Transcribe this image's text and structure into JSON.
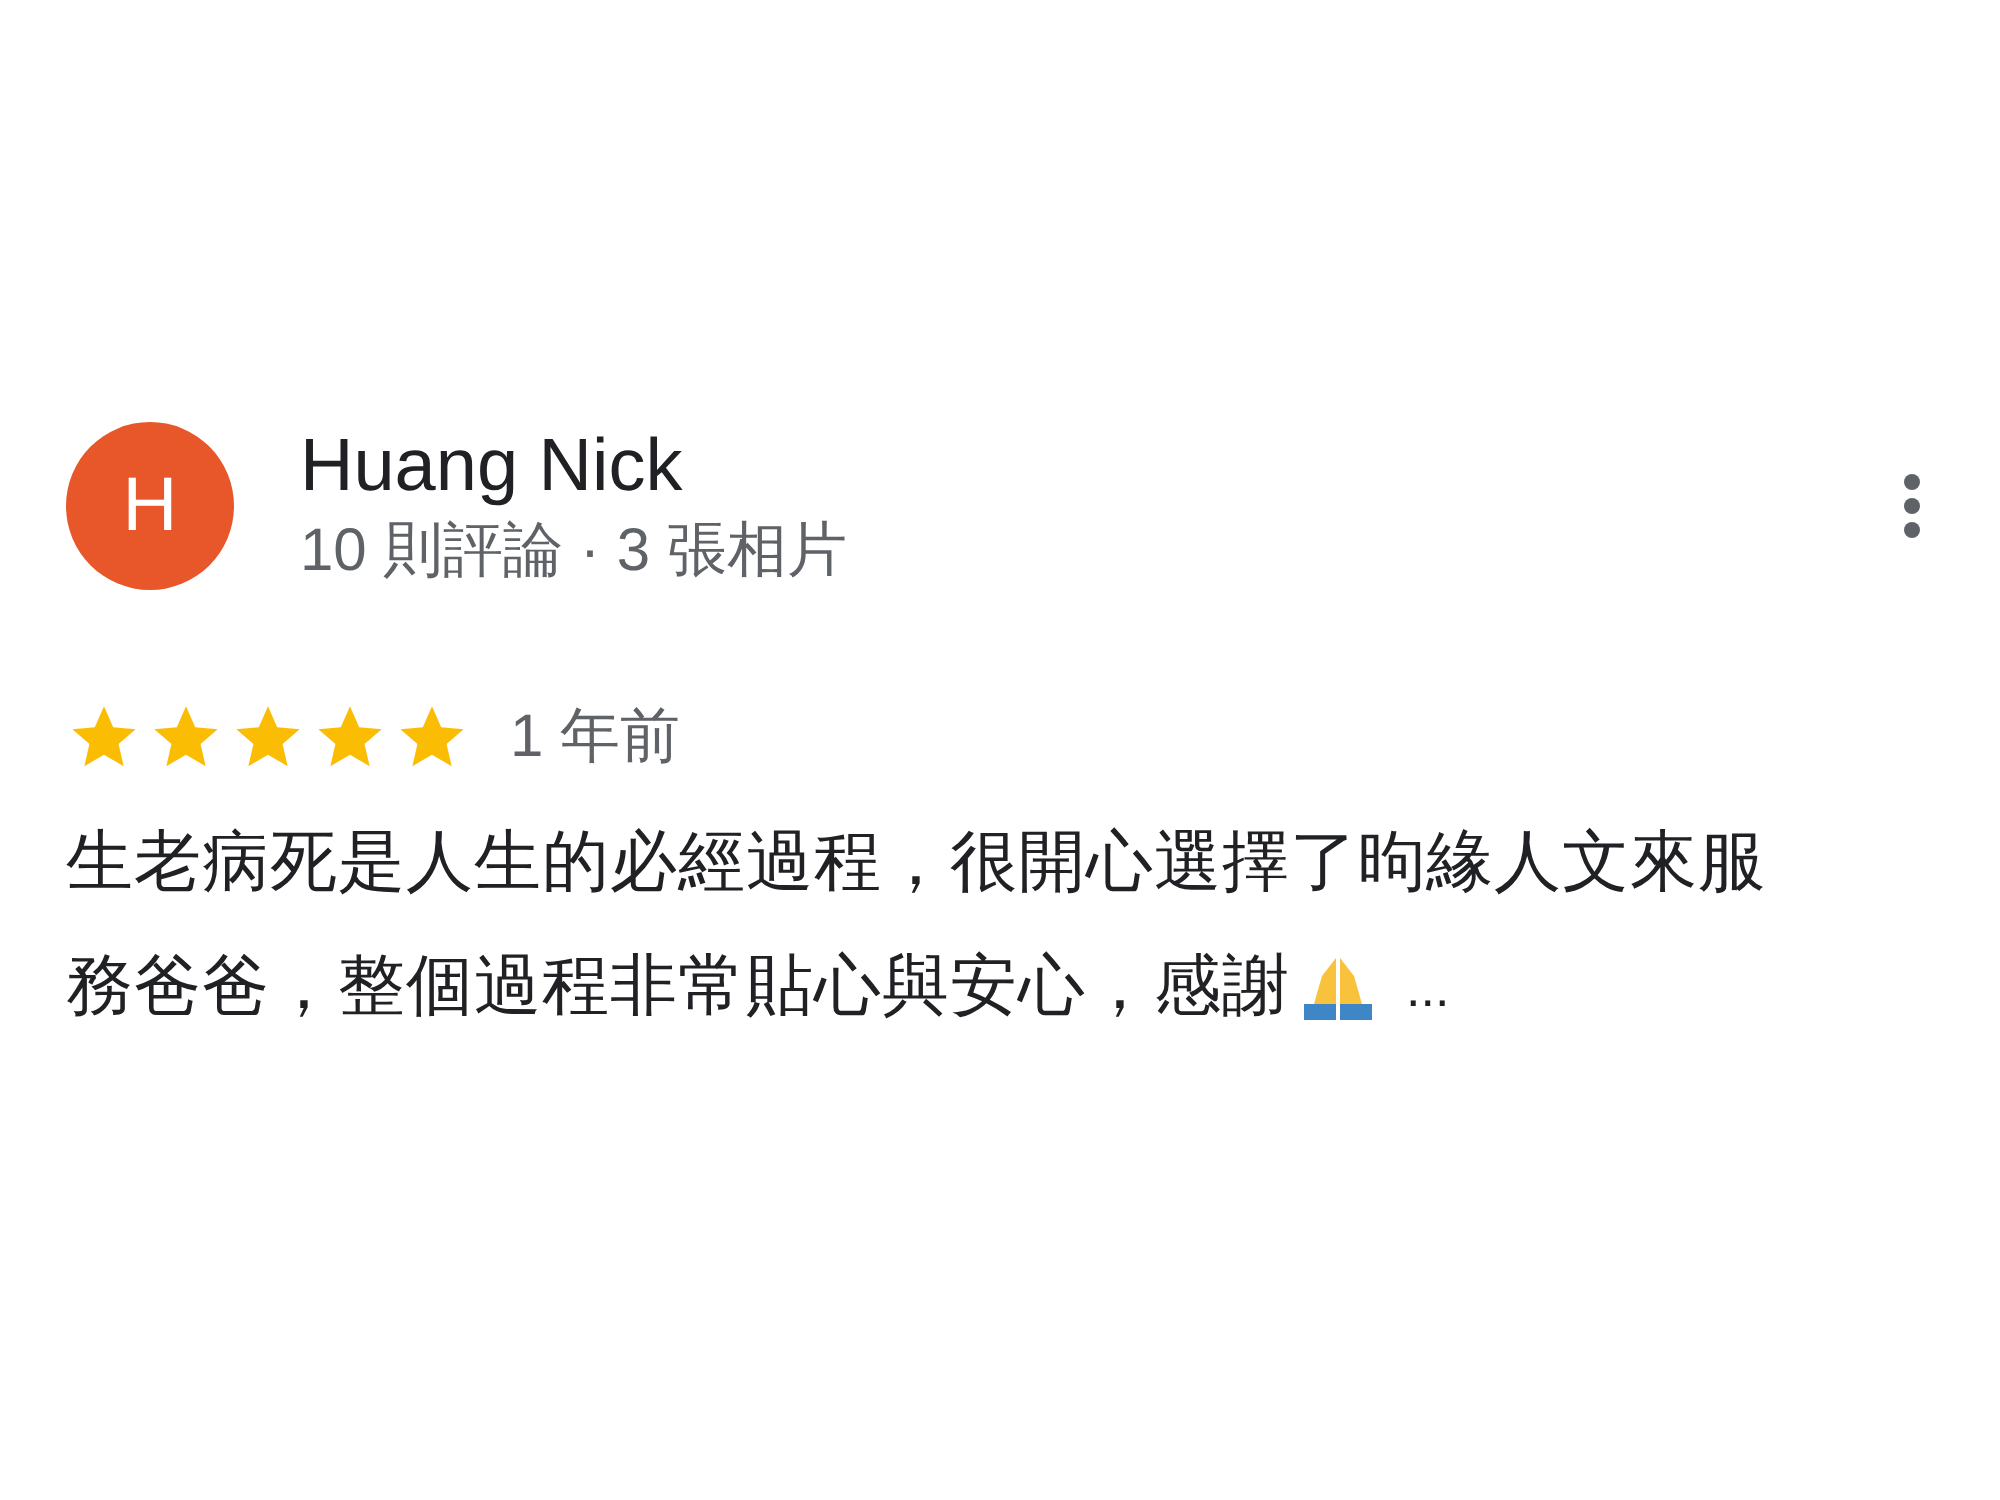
{
  "review": {
    "avatar_letter": "H",
    "author": "Huang Nick",
    "author_meta": "10 則評論 · 3 張相片",
    "stars": 5,
    "time": "1 年前",
    "text_lines": [
      "生老病死是人生的必經過程，很開心選擇了昫緣人文來服",
      "務爸爸，整個過程非常貼心與安心，感謝"
    ],
    "more": "..."
  }
}
